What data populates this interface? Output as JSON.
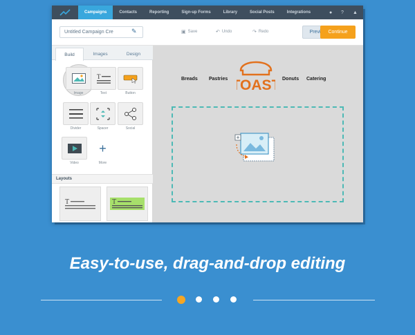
{
  "nav": {
    "items": [
      {
        "label": "Campaigns",
        "active": true
      },
      {
        "label": "Contacts",
        "active": false
      },
      {
        "label": "Reporting",
        "active": false
      },
      {
        "label": "Sign-up Forms",
        "active": false
      },
      {
        "label": "Library",
        "active": false
      },
      {
        "label": "Social Posts",
        "active": false
      },
      {
        "label": "Integrations",
        "active": false
      }
    ],
    "right_icons": [
      "bell-icon",
      "help-icon",
      "user-icon"
    ]
  },
  "toolbar": {
    "campaign_name": "Untitled Campaign Cre",
    "save_label": "Save",
    "undo_label": "Undo",
    "redo_label": "Redo",
    "preview_label": "Preview",
    "continue_label": "Continue"
  },
  "panel": {
    "tabs": [
      {
        "label": "Build",
        "active": true
      },
      {
        "label": "Images",
        "active": false
      },
      {
        "label": "Design",
        "active": false
      }
    ],
    "blocks": [
      {
        "label": "Image",
        "icon": "image-icon"
      },
      {
        "label": "Text",
        "icon": "text-icon"
      },
      {
        "label": "Button",
        "icon": "button-icon"
      },
      {
        "label": "Divider",
        "icon": "divider-icon"
      },
      {
        "label": "Spacer",
        "icon": "spacer-icon"
      },
      {
        "label": "Social",
        "icon": "share-icon"
      },
      {
        "label": "Video",
        "icon": "video-icon"
      },
      {
        "label": "More",
        "icon": "plus-icon"
      }
    ],
    "layouts_header": "Layouts"
  },
  "canvas": {
    "menu": [
      "Breads",
      "Pastries",
      "Donuts",
      "Catering"
    ],
    "logo_text": "TOAST"
  },
  "caption": "Easy-to-use, drag-and-drop editing",
  "pagination": {
    "count": 4,
    "active_index": 0
  },
  "colors": {
    "background": "#3a8fd0",
    "accent_orange": "#f5a11c",
    "nav_active": "#39a7dd",
    "logo_orange": "#e2711d",
    "dropzone": "#4cb9b5"
  }
}
